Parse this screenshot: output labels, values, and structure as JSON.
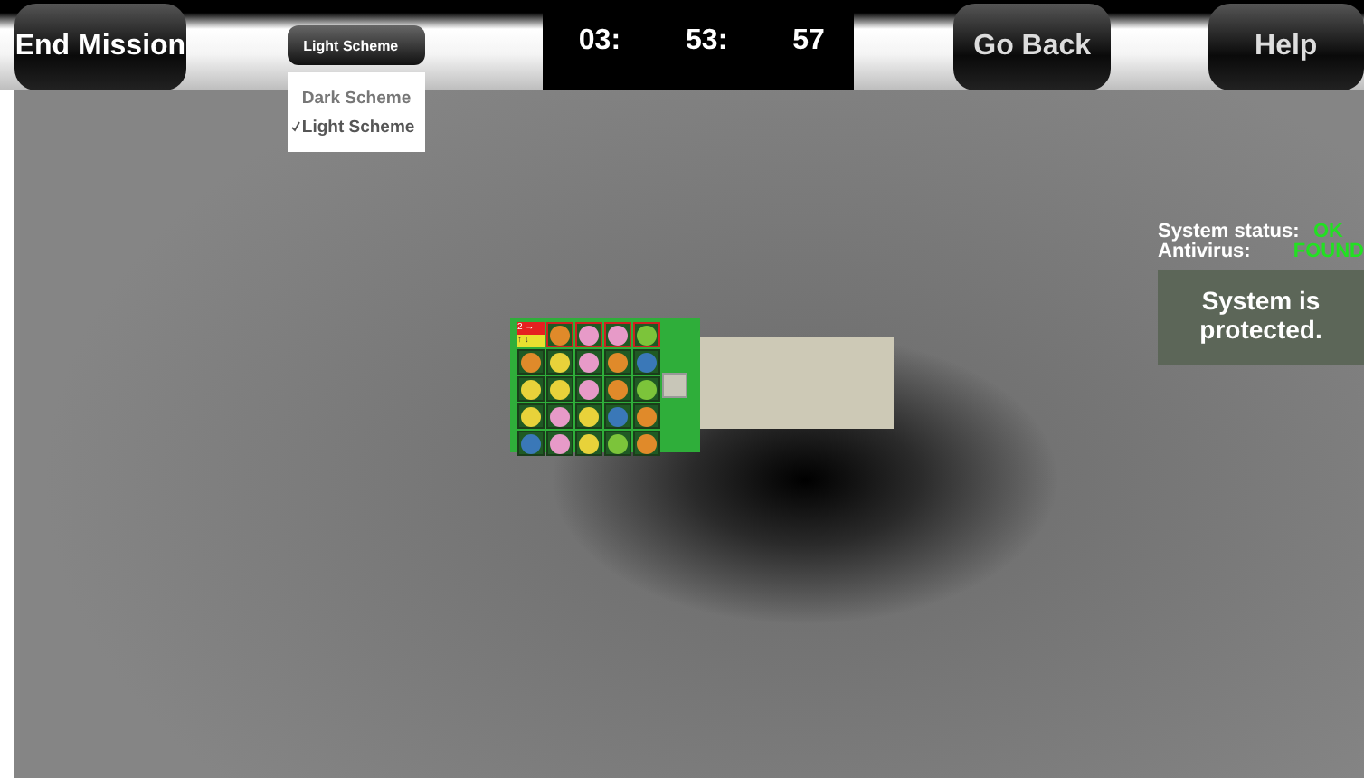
{
  "toolbar": {
    "end_button": "End Mission",
    "scheme_select": {
      "value": "Light Scheme",
      "options": [
        {
          "label": "Dark Scheme",
          "checked": false
        },
        {
          "label": "Light Scheme",
          "checked": true
        }
      ]
    },
    "timer": [
      "03:",
      "53:",
      "57"
    ],
    "back_button": "Go Back",
    "help_button": "Help"
  },
  "game_panel": {
    "label_top": "2 →",
    "label_bottom": "↑ ↓",
    "tiles": [
      {
        "color": "#e08a2a"
      },
      {
        "color": "#e79ac8"
      },
      {
        "color": "#e79ac8"
      },
      {
        "color": "#7cc43a"
      },
      {
        "color": "#e08a2a"
      },
      {
        "color": "#e8d23a"
      },
      {
        "color": "#e79ac8"
      },
      {
        "color": "#e08a2a"
      },
      {
        "color": "#3a78b8"
      },
      {
        "color": "#e8d23a"
      },
      {
        "color": "#e8d23a"
      },
      {
        "color": "#e79ac8"
      },
      {
        "color": "#e08a2a"
      },
      {
        "color": "#7cc43a"
      },
      {
        "color": "#e8d23a"
      },
      {
        "color": "#e79ac8"
      },
      {
        "color": "#e8d23a"
      },
      {
        "color": "#3a78b8"
      },
      {
        "color": "#e08a2a"
      },
      {
        "color": "#3a78b8"
      },
      {
        "color": "#e79ac8"
      },
      {
        "color": "#e8d23a"
      },
      {
        "color": "#7cc43a"
      },
      {
        "color": "#e08a2a"
      }
    ]
  },
  "status": {
    "rows": [
      {
        "label": "System status:",
        "value": "OK"
      },
      {
        "label": "Antivirus:",
        "value": "FOUND"
      }
    ],
    "message": "System is protected."
  }
}
